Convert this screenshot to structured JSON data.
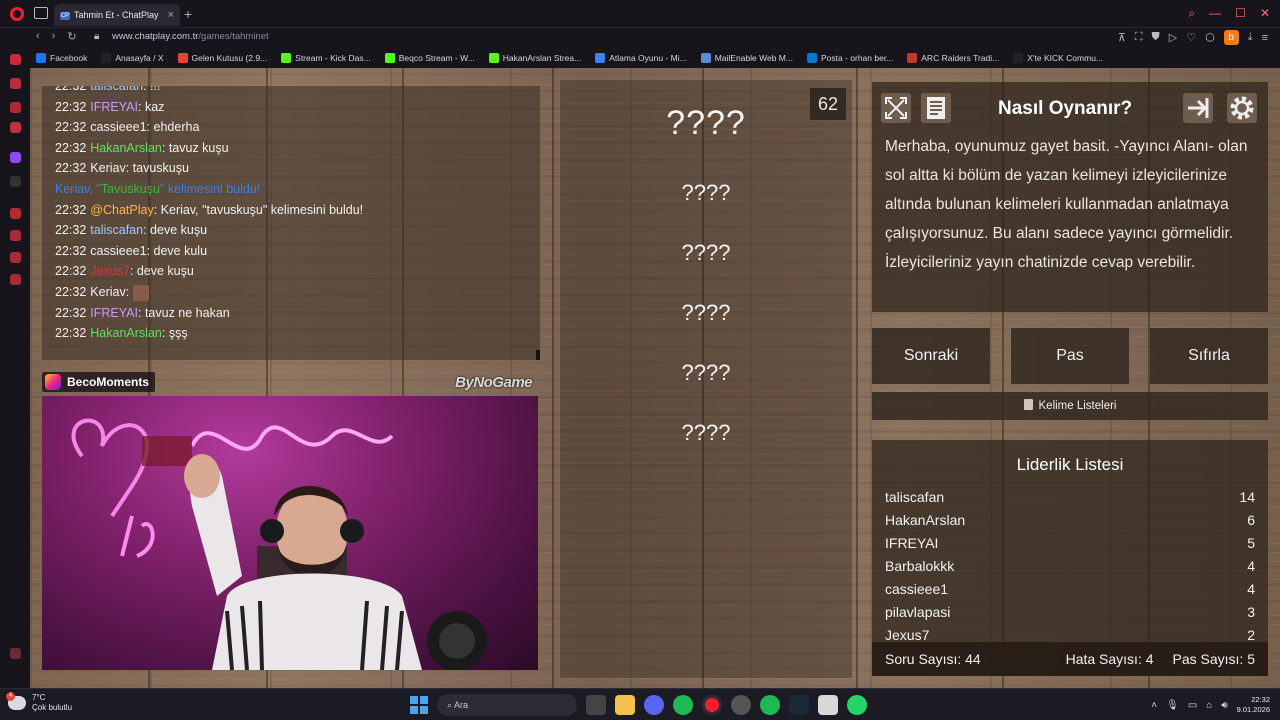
{
  "browser": {
    "tab_title": "Tahmin Et - ChatPlay",
    "tab_favicon": "CP",
    "url_host": "www.chatplay.com.tr",
    "url_path": "/games/tahminet",
    "extension_letter": "b",
    "bookmarks": [
      {
        "label": "Facebook",
        "color": "#1877f2"
      },
      {
        "label": "Anasayfa / X",
        "color": "#222222"
      },
      {
        "label": "Gelen Kutusu (2.9...",
        "color": "#ea4335"
      },
      {
        "label": "Stream - Kick Das...",
        "color": "#53fc18"
      },
      {
        "label": "Beqco Stream - W...",
        "color": "#53fc18"
      },
      {
        "label": "HakanArslan Strea...",
        "color": "#53fc18"
      },
      {
        "label": "Atlama Oyunu - Mi...",
        "color": "#3b82f6"
      },
      {
        "label": "MailEnable Web M...",
        "color": "#5b8bd6"
      },
      {
        "label": "Posta - orhan ber...",
        "color": "#0078d4"
      },
      {
        "label": "ARC Raiders Tradi...",
        "color": "#c0392b"
      },
      {
        "label": "X'te KICK Commu...",
        "color": "#222222"
      }
    ]
  },
  "chat": {
    "messages": [
      {
        "time": "22:32",
        "user": "taliscafan",
        "color": "#9ec9ff",
        "text": "!!!",
        "emote": false
      },
      {
        "time": "22:32",
        "user": "IFREYAI",
        "color": "#c99bff",
        "text": "kaz",
        "emote": false
      },
      {
        "time": "22:32",
        "user": "cassieee1",
        "color": "#f1f1f1",
        "text": "ehderha",
        "emote": false
      },
      {
        "time": "22:32",
        "user": "HakanArslan",
        "color": "#5fe05f",
        "text": "tavuz kuşu",
        "emote": false
      },
      {
        "time": "22:32",
        "user": "Keriav",
        "color": "#f1f1f1",
        "text": "tavuskuşu",
        "emote": false
      },
      {
        "system": true,
        "pre": "Keriav, \"",
        "word": "Tavuskuşu",
        "post": "\" kelimesini buldu!"
      },
      {
        "time": "22:32",
        "user": "@ChatPlay",
        "color": "#ffb74a",
        "text": "Keriav, \"tavuskuşu\" kelimesini buldu!",
        "emote": false
      },
      {
        "time": "22:32",
        "user": "taliscafan",
        "color": "#9ec9ff",
        "text": "deve kuşu",
        "emote": false
      },
      {
        "time": "22:32",
        "user": "cassieee1",
        "color": "#f1f1f1",
        "text": "deve kulu",
        "emote": false
      },
      {
        "time": "22:32",
        "user": "Jexus7",
        "color": "#e0313e",
        "text": "deve kuşu",
        "emote": false
      },
      {
        "time": "22:32",
        "user": "Keriav",
        "color": "#f1f1f1",
        "text": "",
        "emote": true
      },
      {
        "time": "22:32",
        "user": "IFREYAI",
        "color": "#c99bff",
        "text": "tavuz ne hakan",
        "emote": false
      },
      {
        "time": "22:32",
        "user": "HakanArslan",
        "color": "#5fe05f",
        "text": "şşş",
        "emote": false
      }
    ]
  },
  "cam": {
    "channel": "BecoMoments",
    "brand": "ByNoGame"
  },
  "game": {
    "timer": "62",
    "words": [
      "????",
      "????",
      "????",
      "????",
      "????",
      "????"
    ]
  },
  "how_to": {
    "title": "Nasıl Oynanır?",
    "text": "Merhaba, oyunumuz gayet basit. -Yayıncı Alanı- olan sol altta ki bölüm de yazan kelimeyi izleyicilerinize altında bulunan kelimeleri kullanmadan anlatmaya çalışıyorsunuz. Bu alanı sadece yayıncı görmelidir. İzleyicileriniz yayın chatinizde cevap verebilir."
  },
  "controls": {
    "next": "Sonraki",
    "pass": "Pas",
    "reset": "Sıfırla",
    "word_lists": "Kelime Listeleri"
  },
  "leaderboard": {
    "title": "Liderlik Listesi",
    "rows": [
      {
        "name": "taliscafan",
        "score": "14"
      },
      {
        "name": "HakanArslan",
        "score": "6"
      },
      {
        "name": "IFREYAI",
        "score": "5"
      },
      {
        "name": "Barbalokkk",
        "score": "4"
      },
      {
        "name": "cassieee1",
        "score": "4"
      },
      {
        "name": "pilavlapasi",
        "score": "3"
      },
      {
        "name": "Jexus7",
        "score": "2"
      }
    ],
    "question_count_label": "Soru Sayısı: 44",
    "error_count_label": "Hata Sayısı: 4",
    "pass_count_label": "Pas Sayısı: 5"
  },
  "taskbar": {
    "temperature": "7°C",
    "weather": "Çok bulutlu",
    "notif_count": "4",
    "search_placeholder": "Ara",
    "time": "22:32",
    "date": "9.01.2026"
  }
}
